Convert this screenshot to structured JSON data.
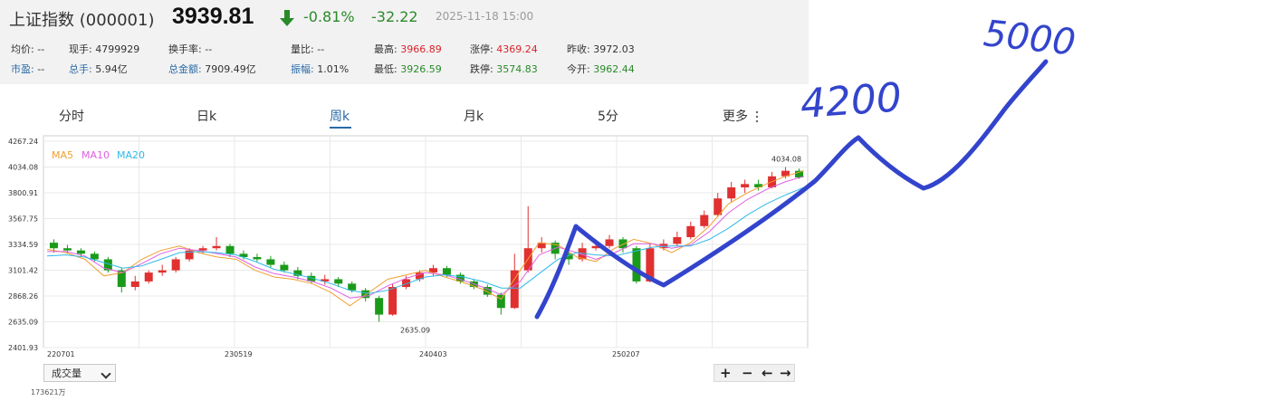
{
  "header": {
    "name": "上证指数 (000001)",
    "price": "3939.81",
    "change_pct": "-0.81%",
    "change": "-32.22",
    "datetime": "2025-11-18 15:00",
    "colors": {
      "down": "#2a8a2a",
      "up": "#d9232a",
      "link": "#2a6aa8"
    },
    "arrow_icon": "arrow-down-icon"
  },
  "stats": {
    "junjia": {
      "label": "均价:",
      "value": "--"
    },
    "xianshou": {
      "label": "现手:",
      "value": "4799929"
    },
    "huanshoulv": {
      "label": "换手率:",
      "value": "--"
    },
    "liangbi": {
      "label": "量比:",
      "value": "--"
    },
    "zuigao": {
      "label": "最高:",
      "value": "3966.89"
    },
    "zhangting": {
      "label": "涨停:",
      "value": "4369.24"
    },
    "zuoshou": {
      "label": "昨收:",
      "value": "3972.03"
    },
    "shiying": {
      "label": "市盈:",
      "value": "--"
    },
    "zongshou": {
      "label": "总手:",
      "value": "5.94亿"
    },
    "zongjine": {
      "label": "总金额:",
      "value": "7909.49亿"
    },
    "zhenfu": {
      "label": "振幅:",
      "value": "1.01%"
    },
    "zuidi": {
      "label": "最低:",
      "value": "3926.59"
    },
    "dieting": {
      "label": "跌停:",
      "value": "3574.83"
    },
    "jinkai": {
      "label": "今开:",
      "value": "3962.44"
    }
  },
  "tabs": [
    {
      "label": "分时"
    },
    {
      "label": "日k"
    },
    {
      "label": "周k",
      "active": true
    },
    {
      "label": "月k"
    },
    {
      "label": "5分"
    },
    {
      "label": "更多"
    }
  ],
  "legend": [
    {
      "label": "MA5",
      "color": "#f0a030"
    },
    {
      "label": "MA10",
      "color": "#e060e0"
    },
    {
      "label": "MA20",
      "color": "#30b8e8"
    }
  ],
  "controls": {
    "volume_select": "成交量",
    "zoom_in": "+",
    "zoom_out": "−",
    "left": "←",
    "right": "→"
  },
  "strip_text": "173621万",
  "handwriting": [
    "4200",
    "5000"
  ],
  "chart_data": {
    "type": "candlestick",
    "y_ticks": [
      4267.24,
      4034.08,
      3800.91,
      3567.75,
      3334.59,
      3101.42,
      2868.26,
      2635.09,
      2401.93
    ],
    "y_tick_labels": [
      "4267.24",
      "4034.08",
      "3800.91",
      "3567.75",
      "3334.59",
      "3101.42",
      "2868.26",
      "2635.09",
      "2401.93"
    ],
    "ylim": [
      2401.93,
      4267.24
    ],
    "x_tick_labels": [
      "220701",
      "230519",
      "240403",
      "250207"
    ],
    "annotations": [
      {
        "text": "4034.08",
        "value": 4034.08
      },
      {
        "text": "2635.09",
        "value": 2635.09
      }
    ],
    "series": [
      {
        "name": "MA5",
        "values": [
          3290,
          3260,
          3200,
          3050,
          3080,
          3200,
          3280,
          3320,
          3260,
          3220,
          3200,
          3100,
          3040,
          3020,
          2980,
          2900,
          2780,
          2900,
          3020,
          3060,
          3100,
          3040,
          2990,
          2930,
          2840,
          3100,
          3350,
          3330,
          3220,
          3180,
          3300,
          3380,
          3340,
          3260,
          3350,
          3500,
          3700,
          3800,
          3880,
          3950,
          4000
        ]
      },
      {
        "name": "MA10",
        "values": [
          3270,
          3270,
          3230,
          3120,
          3080,
          3160,
          3250,
          3300,
          3280,
          3250,
          3220,
          3130,
          3070,
          3040,
          3000,
          2940,
          2850,
          2870,
          2960,
          3030,
          3080,
          3060,
          3010,
          2950,
          2880,
          3000,
          3240,
          3310,
          3260,
          3200,
          3260,
          3340,
          3340,
          3300,
          3330,
          3450,
          3620,
          3740,
          3830,
          3900,
          3950
        ]
      },
      {
        "name": "MA20",
        "values": [
          3230,
          3240,
          3220,
          3170,
          3120,
          3140,
          3200,
          3260,
          3270,
          3260,
          3240,
          3180,
          3110,
          3070,
          3030,
          2980,
          2920,
          2890,
          2920,
          2980,
          3040,
          3060,
          3040,
          3000,
          2940,
          2940,
          3070,
          3200,
          3260,
          3240,
          3230,
          3270,
          3310,
          3320,
          3320,
          3380,
          3480,
          3600,
          3700,
          3780,
          3850
        ]
      }
    ],
    "candles": [
      [
        3350,
        3300,
        3380,
        3260
      ],
      [
        3300,
        3280,
        3330,
        3250
      ],
      [
        3280,
        3250,
        3300,
        3220
      ],
      [
        3250,
        3200,
        3270,
        3180
      ],
      [
        3200,
        3100,
        3220,
        3080
      ],
      [
        3100,
        2950,
        3120,
        2900
      ],
      [
        2950,
        3000,
        3050,
        2920
      ],
      [
        3000,
        3080,
        3100,
        2980
      ],
      [
        3080,
        3100,
        3150,
        3050
      ],
      [
        3100,
        3200,
        3220,
        3080
      ],
      [
        3200,
        3280,
        3300,
        3180
      ],
      [
        3280,
        3300,
        3320,
        3250
      ],
      [
        3300,
        3320,
        3400,
        3280
      ],
      [
        3320,
        3250,
        3340,
        3220
      ],
      [
        3250,
        3220,
        3280,
        3200
      ],
      [
        3220,
        3200,
        3250,
        3180
      ],
      [
        3200,
        3150,
        3230,
        3120
      ],
      [
        3150,
        3100,
        3180,
        3080
      ],
      [
        3100,
        3050,
        3130,
        3020
      ],
      [
        3050,
        3000,
        3080,
        2980
      ],
      [
        3000,
        3020,
        3060,
        2970
      ],
      [
        3020,
        2980,
        3040,
        2950
      ],
      [
        2980,
        2920,
        3000,
        2900
      ],
      [
        2920,
        2850,
        2940,
        2820
      ],
      [
        2850,
        2700,
        2870,
        2635
      ],
      [
        2700,
        2950,
        2980,
        2690
      ],
      [
        2950,
        3020,
        3050,
        2930
      ],
      [
        3020,
        3080,
        3100,
        3000
      ],
      [
        3080,
        3120,
        3150,
        3050
      ],
      [
        3120,
        3060,
        3140,
        3040
      ],
      [
        3060,
        3000,
        3080,
        2980
      ],
      [
        3000,
        2950,
        3020,
        2930
      ],
      [
        2950,
        2880,
        2970,
        2860
      ],
      [
        2880,
        2760,
        2900,
        2700
      ],
      [
        2760,
        3100,
        3250,
        2750
      ],
      [
        3100,
        3300,
        3680,
        3080
      ],
      [
        3300,
        3350,
        3400,
        3260
      ],
      [
        3350,
        3250,
        3370,
        3200
      ],
      [
        3250,
        3200,
        3280,
        3150
      ],
      [
        3200,
        3300,
        3350,
        3180
      ],
      [
        3300,
        3320,
        3380,
        3280
      ],
      [
        3320,
        3380,
        3420,
        3300
      ],
      [
        3380,
        3300,
        3400,
        3260
      ],
      [
        3300,
        3000,
        3320,
        2980
      ],
      [
        3000,
        3300,
        3340,
        2990
      ],
      [
        3300,
        3340,
        3380,
        3280
      ],
      [
        3340,
        3400,
        3450,
        3320
      ],
      [
        3400,
        3500,
        3540,
        3380
      ],
      [
        3500,
        3600,
        3640,
        3480
      ],
      [
        3600,
        3750,
        3800,
        3580
      ],
      [
        3750,
        3850,
        3900,
        3720
      ],
      [
        3850,
        3880,
        3920,
        3800
      ],
      [
        3880,
        3850,
        3920,
        3820
      ],
      [
        3850,
        3950,
        3990,
        3840
      ],
      [
        3950,
        4000,
        4034.08,
        3930
      ],
      [
        4000,
        3939.81,
        4020,
        3926.59
      ]
    ]
  }
}
